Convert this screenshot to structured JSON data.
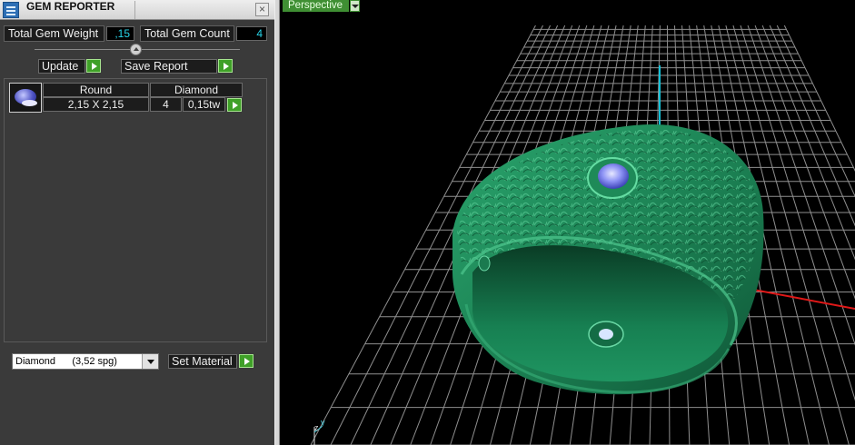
{
  "panel": {
    "title": "GEM REPORTER",
    "close_label": "×",
    "total_weight_label": "Total Gem Weight",
    "total_weight_value": ",15",
    "total_count_label": "Total Gem Count",
    "total_count_value": "4",
    "update_label": "Update",
    "save_report_label": "Save Report"
  },
  "gem_table": {
    "header": {
      "shape": "Round",
      "material": "Diamond"
    },
    "rows": [
      {
        "size": "2,15 X 2,15",
        "count": "4",
        "weight": "0,15tw"
      }
    ]
  },
  "material": {
    "selected": "Diamond      (3,52 spg)",
    "set_label": "Set Material"
  },
  "viewport": {
    "view_mode": "Perspective",
    "axis_labels": {
      "y": "y",
      "z": "z"
    }
  },
  "colors": {
    "accent_green": "#3fa028",
    "value_cyan": "#27d4e8",
    "ring_green": "#1f8a5c",
    "gem_blue": "#7c84f0",
    "grid": "#9a9a9a"
  },
  "icons": {
    "app": "gem-reporter-app-icon",
    "close": "close-icon",
    "go": "green-arrow-icon",
    "dropdown": "chevron-down-icon"
  }
}
